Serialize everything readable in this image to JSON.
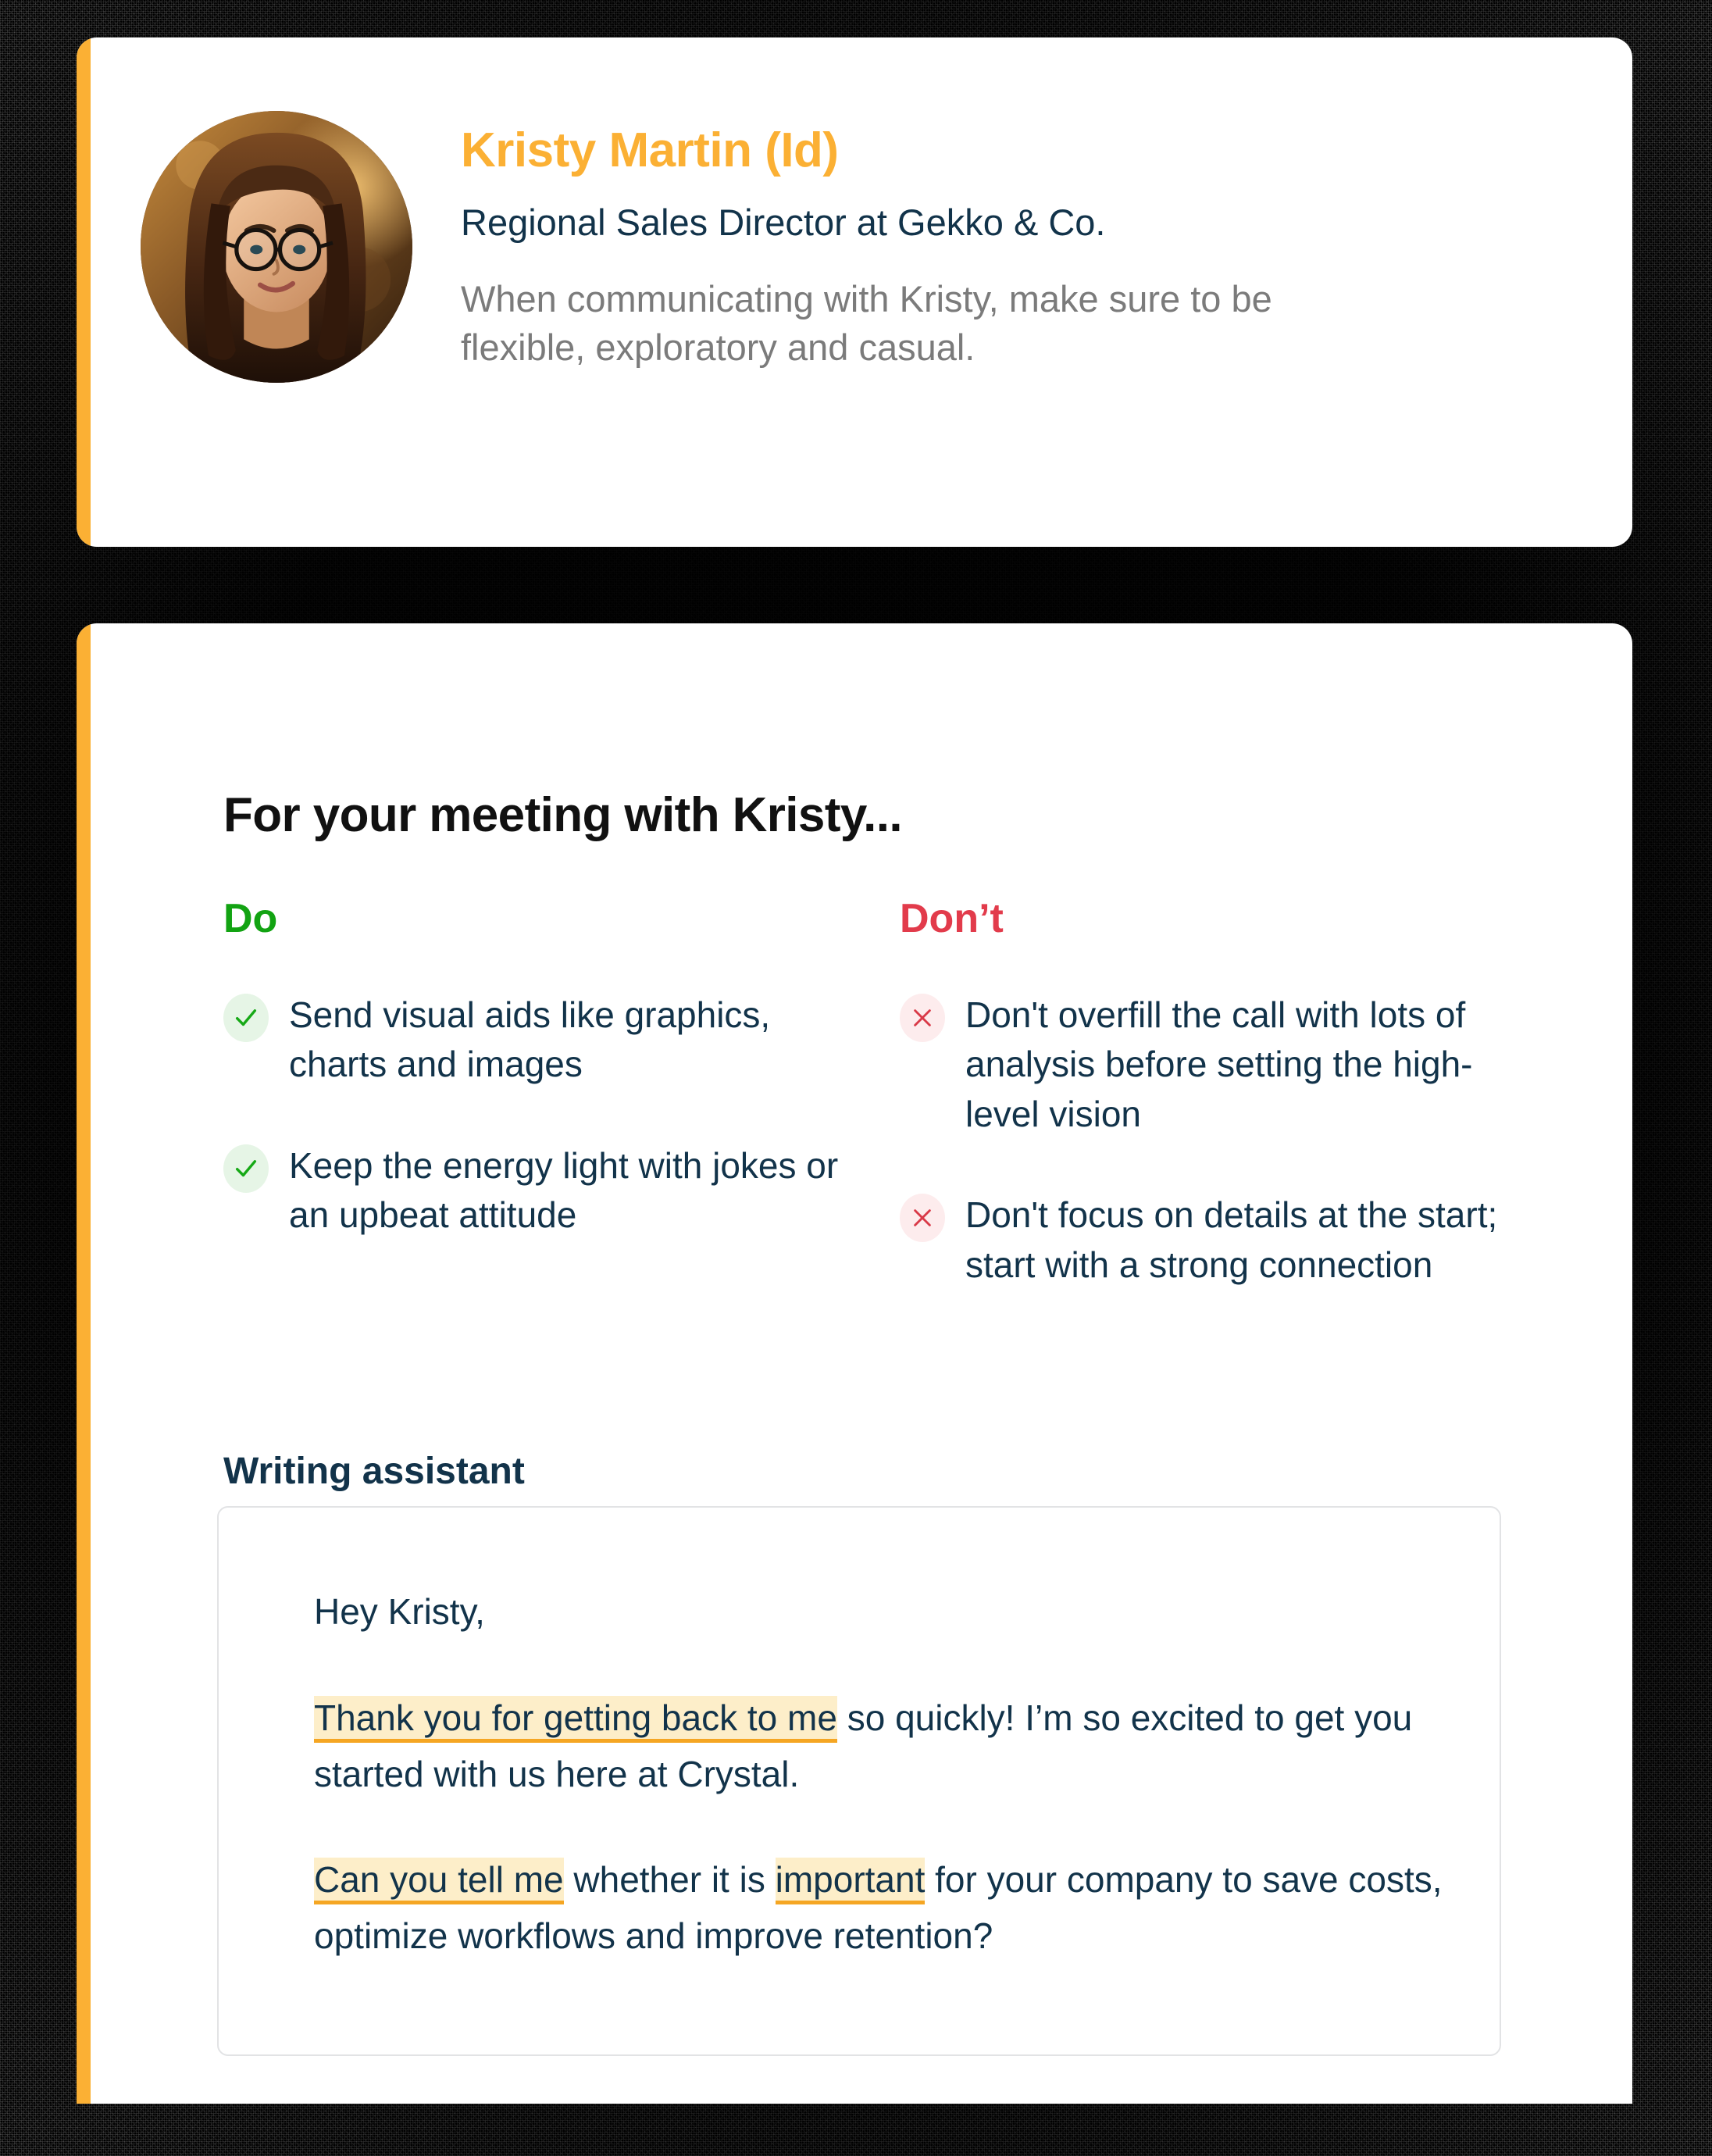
{
  "theme": {
    "accent_yellow": "#fbb034",
    "text_dark": "#12334a",
    "do_green": "#12a312",
    "dont_red": "#e23b4b",
    "highlight_bg": "#fdeec9",
    "highlight_underline": "#f5a623",
    "muted_gray": "#7b7b7b",
    "card_bg": "#ffffff",
    "backdrop": "#000000"
  },
  "profile": {
    "avatar_alt": "Kristy Martin profile photo",
    "name": "Kristy Martin (Id)",
    "role": "Regional Sales Director at Gekko & Co.",
    "advice": "When communicating with Kristy, make sure to be flexible, exploratory and casual."
  },
  "meeting": {
    "title": "For your meeting with Kristy...",
    "do": {
      "heading": "Do",
      "icon": "check-icon",
      "items": [
        "Send visual aids like graphics, charts and images",
        "Keep the energy light with jokes or an upbeat attitude"
      ]
    },
    "dont": {
      "heading": "Don’t",
      "icon": "cross-icon",
      "items": [
        "Don't overfill the call with lots of analysis before setting the high-level vision",
        "Don't focus on details at the start; start with a strong connection"
      ]
    }
  },
  "writing_assistant": {
    "heading": "Writing assistant",
    "email": {
      "greeting": "Hey Kristy,",
      "paragraph_1": {
        "highlight_1": "Thank you for getting back to me",
        "rest": " so quickly! I’m so excited to get you started with us here at Crystal."
      },
      "paragraph_2": {
        "highlight_1": "Can you tell me",
        "middle": " whether it is ",
        "highlight_2": "important",
        "rest": " for your company to save costs, optimize workflows and improve retention?"
      }
    }
  }
}
